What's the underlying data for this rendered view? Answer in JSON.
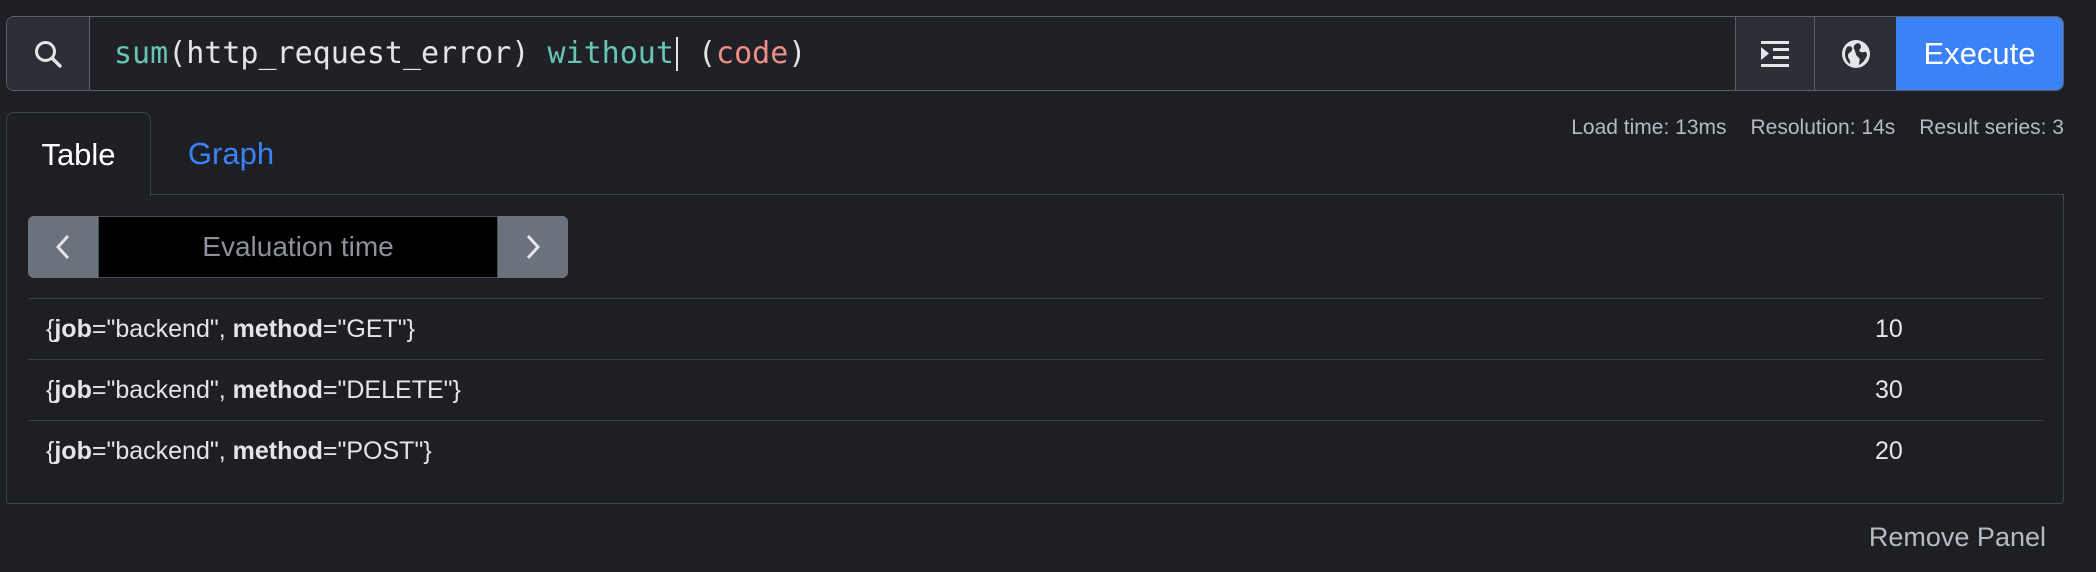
{
  "query": {
    "tokens": [
      {
        "text": "sum",
        "kind": "fn"
      },
      {
        "text": "(http_request_error) ",
        "kind": "plain"
      },
      {
        "text": "without",
        "kind": "kw"
      },
      {
        "text": " (",
        "kind": "plain"
      },
      {
        "text": "code",
        "kind": "label"
      },
      {
        "text": ")",
        "kind": "plain"
      }
    ],
    "execute_label": "Execute"
  },
  "stats": {
    "load_time": "Load time: 13ms",
    "resolution": "Resolution: 14s",
    "result_series": "Result series: 3"
  },
  "tabs": {
    "table": "Table",
    "graph": "Graph"
  },
  "eval": {
    "placeholder": "Evaluation time"
  },
  "results": [
    {
      "job_key": "job",
      "job_val": "=\"backend\", ",
      "method_key": "method",
      "method_val": "=\"GET\"}",
      "value": "10"
    },
    {
      "job_key": "job",
      "job_val": "=\"backend\", ",
      "method_key": "method",
      "method_val": "=\"DELETE\"}",
      "value": "30"
    },
    {
      "job_key": "job",
      "job_val": "=\"backend\", ",
      "method_key": "method",
      "method_val": "=\"POST\"}",
      "value": "20"
    }
  ],
  "footer": {
    "remove_panel": "Remove Panel"
  },
  "icons": {
    "search": "search-icon",
    "format": "format-indent-icon",
    "globe": "globe-icon",
    "prev": "chevron-left-icon",
    "next": "chevron-right-icon"
  },
  "colors": {
    "accent": "#3b82f6",
    "fn": "#67c5b0",
    "label": "#ef8d86",
    "background": "#1d1f24"
  }
}
